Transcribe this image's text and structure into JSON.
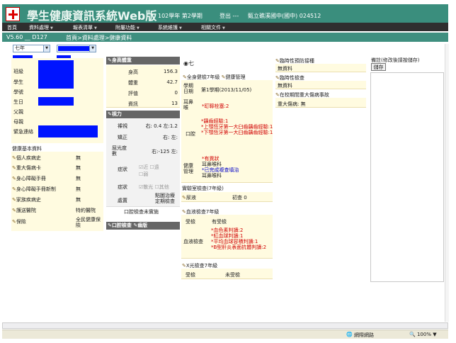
{
  "header": {
    "title": "學生健康資訊系統Web版",
    "term": "102學年 第2學期",
    "logout": "登出",
    "dashes": "---",
    "school": "甄立礁溪國中(國中) 024512"
  },
  "menu": [
    "首頁",
    "資料處理",
    "報表清單",
    "附屬功能",
    "系統維護",
    "相關文件"
  ],
  "subbar": {
    "version": "V5.60 __ D127",
    "breadcrumb": "首頁>資料處理>健康資料"
  },
  "filters": {
    "grade": "七年"
  },
  "basic": {
    "labels": [
      "班級",
      "學生",
      "學號",
      "生日",
      "父親",
      "母親",
      "緊急連絡"
    ],
    "section_title": "健康基本資料",
    "items": [
      {
        "label": "個人疾病史",
        "value": "無"
      },
      {
        "label": "重大傷病卡",
        "value": "無"
      },
      {
        "label": "身心障礙手冊",
        "value": "無"
      },
      {
        "label": "身心障礙手冊新制",
        "value": "無"
      },
      {
        "label": "家族疾病史",
        "value": "無"
      },
      {
        "label": "護送醫院",
        "value": "特約醫院"
      },
      {
        "label": "保險",
        "value": "全民健康保險"
      }
    ]
  },
  "body": {
    "title": "身高體重",
    "rows": [
      {
        "label": "身高",
        "value": "156.3"
      },
      {
        "label": "體重",
        "value": "42.7"
      },
      {
        "label": "評值",
        "value": "0"
      },
      {
        "label": "資訊",
        "value": "13"
      }
    ]
  },
  "vision": {
    "title": "視力",
    "rows": [
      {
        "label": "裸視",
        "value": "右: 0.4 左:1.2"
      },
      {
        "label": "矯正",
        "value": "右: 左:"
      },
      {
        "label": "屈光度數",
        "value": "右:-125 左:"
      },
      {
        "label": "症狀",
        "value": ""
      },
      {
        "label": "症狀",
        "value": ""
      },
      {
        "label": "處置",
        "value": "點圖治療定期檢查"
      }
    ],
    "checks1": [
      "近",
      "遠",
      "弱"
    ],
    "checks2": [
      "散光",
      "其他"
    ]
  },
  "oral": {
    "check_text": "口腔檢查未實施",
    "bar_text": "口腔檢查",
    "bar_text2": "齒版"
  },
  "exam": {
    "grade_marker": "七",
    "title": "全身健檢7年級",
    "title2": "健康管理",
    "date_label": "學期日期",
    "date_value": "第1學期(2013/11/05)",
    "ent_label": "耳鼻喉",
    "ent_value": "*耵聹栓塞:2",
    "oral_label": "口腔",
    "oral_lines": [
      "*齲齒經驗:1",
      "*上顎恆牙第一大臼齒齲齒經驗:1",
      "*下顎恆牙第一大臼齒齲齒經驗:1"
    ],
    "mgmt_label": "健康管理",
    "mgmt_lines": [
      "*有異狀",
      "耳鼻喉科",
      "*已完成複查填治",
      "耳鼻喉科"
    ]
  },
  "lab": {
    "title": "實驗室檢查(7年級)",
    "urine_label": "尿液",
    "urine_value": "初查 0",
    "blood_title": "血液檢查7年級",
    "blood_exam_label": "受檢",
    "blood_exam_value": "有受檢",
    "blood_label": "血液檢查",
    "blood_lines": [
      "*血色素判讀:2",
      "*紅血球判讀:1",
      "*平均血球容積判讀:1",
      "*B型肝炎表面抗體判讀:2"
    ],
    "xray_title": "X光檢查7年級",
    "xray_label": "受檢",
    "xray_value": "未受檢"
  },
  "right": {
    "vaccine_title": "臨時性預防接種",
    "vaccine_value": "無資料",
    "temp_title": "臨時性檢查",
    "temp_value": "無資料",
    "injury_title": "在校期間重大傷病事故",
    "injury_value": "重大傷病: 無",
    "note_label": "備註(修改後請按儲存)",
    "save": "儲存"
  },
  "status": {
    "network": "網際網路",
    "zoom": "100%"
  }
}
